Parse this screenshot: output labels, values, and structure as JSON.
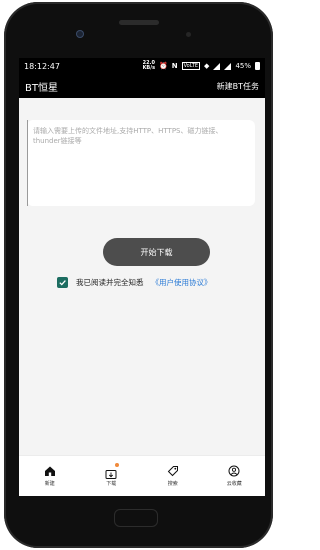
{
  "status": {
    "time": "18:12:47",
    "speed_value": "22.0",
    "speed_unit": "KB/s",
    "network": "VoLTE",
    "battery": "45%"
  },
  "appbar": {
    "title": "BT恒星",
    "action": "新建BT任务"
  },
  "input": {
    "placeholder": "请输入需要上传的文件地址,支持HTTP、HTTPS、磁力链接、thunder链接等",
    "value": ""
  },
  "start_button": "开始下载",
  "agreement": {
    "checked": true,
    "text": "我已阅读并完全知悉",
    "link": "《用户使用协议》"
  },
  "tabs": [
    {
      "label": "新建",
      "icon": "home-icon"
    },
    {
      "label": "下载",
      "icon": "download-folder-icon"
    },
    {
      "label": "搜索",
      "icon": "tag-icon"
    },
    {
      "label": "云收藏",
      "icon": "user-circle-icon"
    }
  ],
  "colors": {
    "appbar": "#000000",
    "button": "#4d4d4d",
    "checkbox": "#1c6d61",
    "link": "#2b7bd6",
    "badge": "#f08a3c"
  }
}
